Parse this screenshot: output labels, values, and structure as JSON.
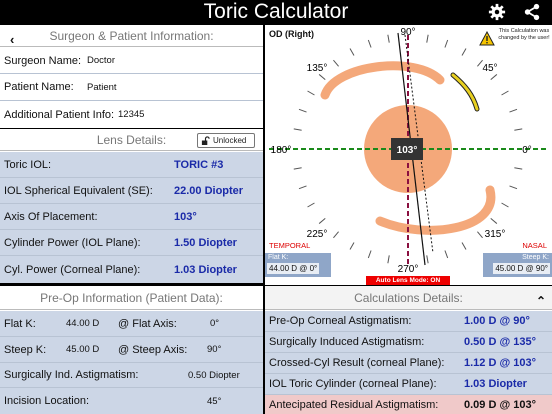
{
  "app": {
    "title": "Toric Calculator",
    "gear_icon": "gear-icon",
    "share_icon": "share-icon"
  },
  "surgeon": {
    "header": "Surgeon & Patient Information:",
    "surgeon_name_label": "Surgeon Name:",
    "surgeon_name": "Doctor",
    "patient_name_label": "Patient Name:",
    "patient_name": "Patient",
    "patient_info_label": "Additional Patient Info:",
    "patient_info": "12345"
  },
  "lens": {
    "header": "Lens Details:",
    "lock_label": "Unlocked",
    "rows": [
      {
        "label": "Toric IOL:",
        "value": "TORIC #3"
      },
      {
        "label": "IOL Spherical Equivalent (SE):",
        "value": "22.00 Diopter"
      },
      {
        "label": "Axis Of Placement:",
        "value": "103°"
      },
      {
        "label": "Cylinder Power (IOL Plane):",
        "value": "1.50 Diopter"
      },
      {
        "label": "Cyl. Power (Corneal Plane):",
        "value": "1.03 Diopter"
      }
    ]
  },
  "diagram": {
    "eye_label": "OD (Right)",
    "warning": "This Calculation was changed by the user!",
    "angles": {
      "a0": "0°",
      "a45": "45°",
      "a90": "90°",
      "a135": "135°",
      "a180": "180°",
      "a225": "225°",
      "a270": "270°",
      "a315": "315°"
    },
    "axis_value": "103°",
    "axis_degrees": 103,
    "temporal": "TEMPORAL",
    "nasal": "NASAL",
    "flat_k_label": "Flat K:",
    "flat_k_value": "44.00 D @ 0°",
    "steep_k_label": "Steep K:",
    "steep_k_value": "45.00 D @ 90°",
    "auto_lens": "Auto Lens Mode: ON",
    "colors": {
      "flat": "#1a8a1a",
      "steep": "#8a1040",
      "lens": "#f4a87a",
      "haptic": "#e0b030"
    }
  },
  "preop": {
    "header": "Pre-Op Information (Patient Data):",
    "flat_k_label": "Flat K:",
    "flat_k_value": "44.00 D",
    "flat_axis_label": "@ Flat Axis:",
    "flat_axis_value": "0°",
    "steep_k_label": "Steep K:",
    "steep_k_value": "45.00 D",
    "steep_axis_label": "@ Steep Axis:",
    "steep_axis_value": "90°",
    "sia_label": "Surgically Ind. Astigmatism:",
    "sia_value": "0.50 Diopter",
    "incision_label": "Incision Location:",
    "incision_value": "45°"
  },
  "calc": {
    "header": "Calculations Details:",
    "rows": [
      {
        "label": "Pre-Op Corneal Astigmatism:",
        "value": "1.00 D @ 90°"
      },
      {
        "label": "Surgically Induced Astigmatism:",
        "value": "0.50 D @ 135°"
      },
      {
        "label": "Crossed-Cyl Result (corneal Plane):",
        "value": "1.12 D @ 103°"
      },
      {
        "label": "IOL Toric Cylinder (corneal Plane):",
        "value": "1.03 Diopter"
      },
      {
        "label": "Antecipated Residual Astigmatism:",
        "value": "0.09 D @ 103°"
      }
    ]
  }
}
